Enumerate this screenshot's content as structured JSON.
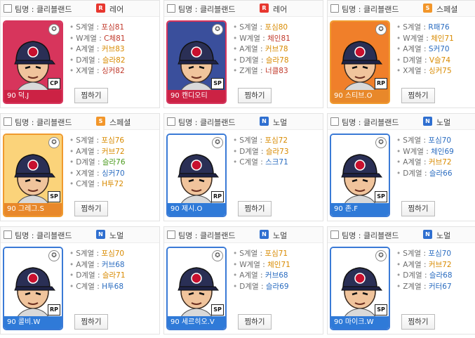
{
  "cards": [
    {
      "team": "팀명 : 클리블랜드",
      "grade_letter": "R",
      "grade": "레어",
      "grade_color": "#e8372f",
      "frame": "#d7355c",
      "bg": "#d7355c",
      "plate": "#cc2244",
      "pos": "CP",
      "name": "90 덕.J",
      "stats": [
        {
          "k": "S계열",
          "v": "포심81",
          "c": "c-red"
        },
        {
          "k": "W계열",
          "v": "C체81",
          "c": "c-red"
        },
        {
          "k": "A계열",
          "v": "커브83",
          "c": "c-orange"
        },
        {
          "k": "D계열",
          "v": "슬라82",
          "c": "c-orange"
        },
        {
          "k": "X계열",
          "v": "싱커82",
          "c": "c-red"
        }
      ]
    },
    {
      "team": "팀명 : 클리블랜드",
      "grade_letter": "R",
      "grade": "레어",
      "grade_color": "#e8372f",
      "frame": "#d7355c",
      "bg": "#3a4f9c",
      "plate": "#cc2244",
      "pos": "SP",
      "name": "90 캔디오티",
      "stats": [
        {
          "k": "S계열",
          "v": "포심80",
          "c": "c-orange"
        },
        {
          "k": "W계열",
          "v": "체인81",
          "c": "c-red"
        },
        {
          "k": "A계열",
          "v": "커브78",
          "c": "c-orange"
        },
        {
          "k": "D계열",
          "v": "슬라78",
          "c": "c-orange"
        },
        {
          "k": "Z계열",
          "v": "너클83",
          "c": "c-red"
        }
      ]
    },
    {
      "team": "팀명 : 클리블랜드",
      "grade_letter": "S",
      "grade": "스페셜",
      "grade_color": "#f2962a",
      "frame": "#f09a2e",
      "bg": "#f07f2a",
      "plate": "#e8882a",
      "pos": "RP",
      "name": "90 스티브.O",
      "stats": [
        {
          "k": "S계열",
          "v": "R패76",
          "c": "c-blue"
        },
        {
          "k": "W계열",
          "v": "체인71",
          "c": "c-orange"
        },
        {
          "k": "A계열",
          "v": "S커70",
          "c": "c-blue"
        },
        {
          "k": "D계열",
          "v": "V슬74",
          "c": "c-orange"
        },
        {
          "k": "X계열",
          "v": "싱커75",
          "c": "c-orange"
        }
      ]
    },
    {
      "team": "팀명 : 클리블랜드",
      "grade_letter": "S",
      "grade": "스페셜",
      "grade_color": "#f2962a",
      "frame": "#f09a2e",
      "bg": "#fbd37a",
      "plate": "#e8882a",
      "pos": "SP",
      "name": "90 그레그.S",
      "stats": [
        {
          "k": "S계열",
          "v": "포심76",
          "c": "c-orange"
        },
        {
          "k": "A계열",
          "v": "커브72",
          "c": "c-orange"
        },
        {
          "k": "D계열",
          "v": "슬라76",
          "c": "c-green"
        },
        {
          "k": "X계열",
          "v": "싱커70",
          "c": "c-blue"
        },
        {
          "k": "C계열",
          "v": "H투72",
          "c": "c-orange"
        }
      ]
    },
    {
      "team": "팀명 : 클리블랜드",
      "grade_letter": "N",
      "grade": "노멀",
      "grade_color": "#2f6fd0",
      "frame": "#3a7ad6",
      "bg": "#ffffff",
      "plate": "#2f7ad8",
      "pos": "RP",
      "name": "90 제시.O",
      "stats": [
        {
          "k": "S계열",
          "v": "포심72",
          "c": "c-orange"
        },
        {
          "k": "D계열",
          "v": "슬라73",
          "c": "c-orange"
        },
        {
          "k": "C계열",
          "v": "스크71",
          "c": "c-blue"
        }
      ]
    },
    {
      "team": "팀명 : 클리블랜드",
      "grade_letter": "N",
      "grade": "노멀",
      "grade_color": "#2f6fd0",
      "frame": "#3a7ad6",
      "bg": "#ffffff",
      "plate": "#2f7ad8",
      "pos": "SP",
      "name": "90 존.F",
      "stats": [
        {
          "k": "S계열",
          "v": "포심70",
          "c": "c-blue"
        },
        {
          "k": "W계열",
          "v": "체인69",
          "c": "c-blue"
        },
        {
          "k": "A계열",
          "v": "커브72",
          "c": "c-orange"
        },
        {
          "k": "D계열",
          "v": "슬라66",
          "c": "c-blue"
        }
      ]
    },
    {
      "team": "팀명 : 클리블랜드",
      "grade_letter": "N",
      "grade": "노멀",
      "grade_color": "#2f6fd0",
      "frame": "#3a7ad6",
      "bg": "#ffffff",
      "plate": "#2f7ad8",
      "pos": "RP",
      "name": "90 콜비.W",
      "stats": [
        {
          "k": "S계열",
          "v": "포심70",
          "c": "c-orange"
        },
        {
          "k": "A계열",
          "v": "커브68",
          "c": "c-blue"
        },
        {
          "k": "D계열",
          "v": "슬라71",
          "c": "c-orange"
        },
        {
          "k": "C계열",
          "v": "H투68",
          "c": "c-blue"
        }
      ]
    },
    {
      "team": "팀명 : 클리블랜드",
      "grade_letter": "N",
      "grade": "노멀",
      "grade_color": "#2f6fd0",
      "frame": "#3a7ad6",
      "bg": "#ffffff",
      "plate": "#2f7ad8",
      "pos": "SP",
      "name": "90 세르히오.V",
      "stats": [
        {
          "k": "S계열",
          "v": "포심71",
          "c": "c-orange"
        },
        {
          "k": "W계열",
          "v": "체인71",
          "c": "c-orange"
        },
        {
          "k": "A계열",
          "v": "커브68",
          "c": "c-blue"
        },
        {
          "k": "D계열",
          "v": "슬라69",
          "c": "c-blue"
        }
      ]
    },
    {
      "team": "팀명 : 클리블랜드",
      "grade_letter": "N",
      "grade": "노멀",
      "grade_color": "#2f6fd0",
      "frame": "#3a7ad6",
      "bg": "#ffffff",
      "plate": "#2f7ad8",
      "pos": "SP",
      "name": "90 마이크.W",
      "stats": [
        {
          "k": "S계열",
          "v": "포심70",
          "c": "c-blue"
        },
        {
          "k": "A계열",
          "v": "커브72",
          "c": "c-orange"
        },
        {
          "k": "D계열",
          "v": "슬라68",
          "c": "c-blue"
        },
        {
          "k": "Z계열",
          "v": "커터67",
          "c": "c-blue"
        }
      ]
    }
  ],
  "ui": {
    "pick_label": "찜하기",
    "bullet": "•"
  }
}
